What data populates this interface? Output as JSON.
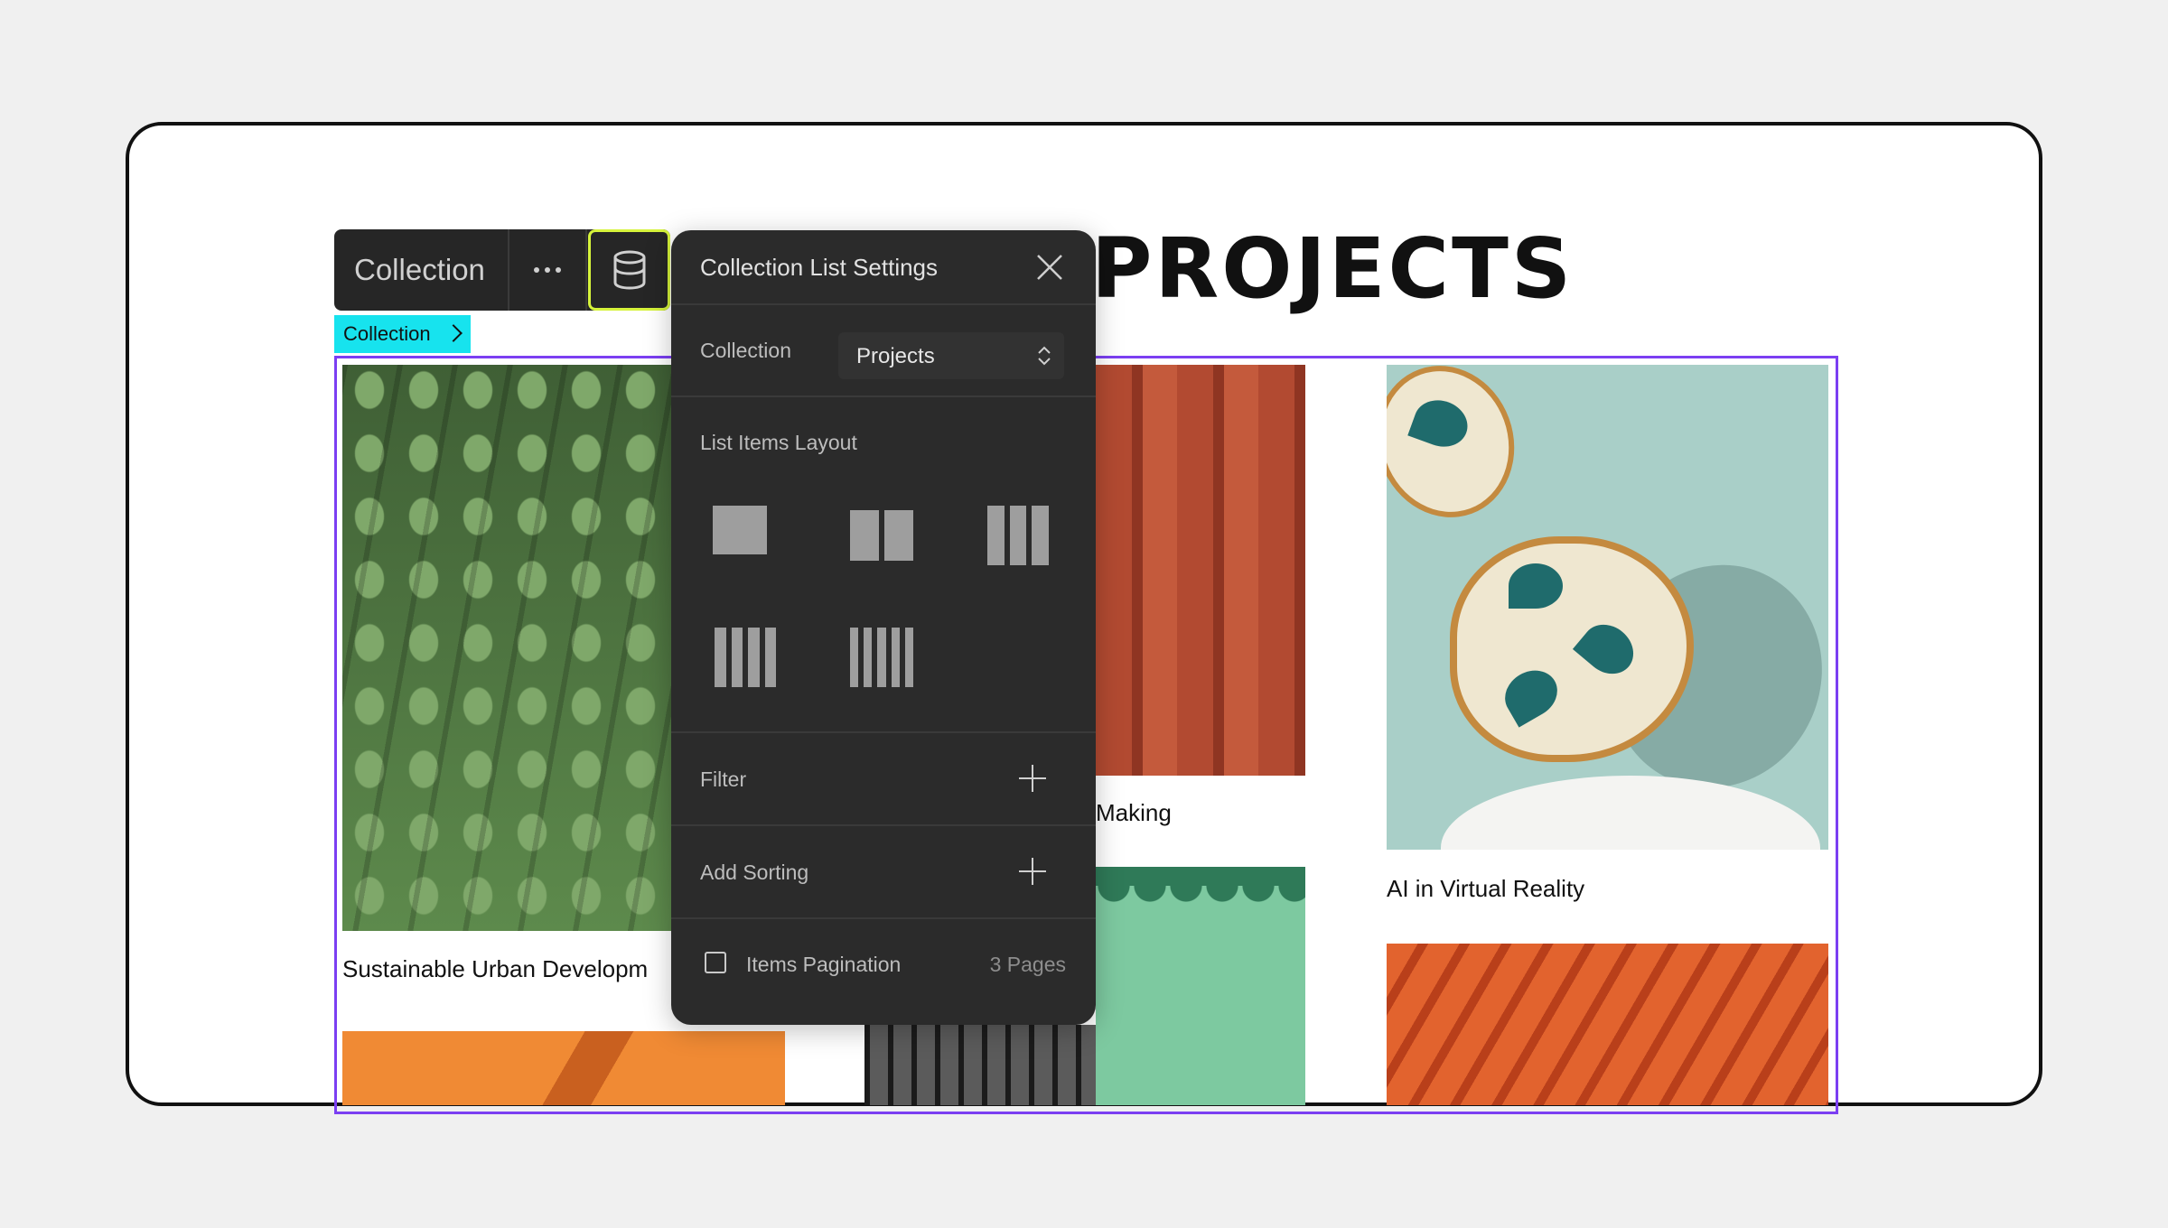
{
  "page": {
    "heading": "PROJECTS",
    "colors": {
      "selection_outline": "#7b3ff2",
      "breadcrumb_bg": "#17e3ee",
      "active_highlight": "#d6f33b",
      "panel_bg": "#2b2b2b"
    }
  },
  "toolbar": {
    "label": "Collection",
    "more_icon": "more-horizontal-icon",
    "database_icon": "database-icon"
  },
  "breadcrumb": {
    "label": "Collection"
  },
  "settings_panel": {
    "title": "Collection List Settings",
    "collection_label": "Collection",
    "collection_value": "Projects",
    "layout_label": "List Items Layout",
    "layout_options": [
      "1 column",
      "2 columns",
      "3 columns",
      "4 columns",
      "5 columns"
    ],
    "filter_label": "Filter",
    "sorting_label": "Add Sorting",
    "pagination_label": "Items Pagination",
    "pagination_checked": false,
    "pagination_pages": "3 Pages"
  },
  "cards": [
    {
      "title": "Sustainable Urban Developm"
    },
    {
      "title": "Making"
    },
    {
      "title": "AI in Virtual Reality"
    }
  ]
}
